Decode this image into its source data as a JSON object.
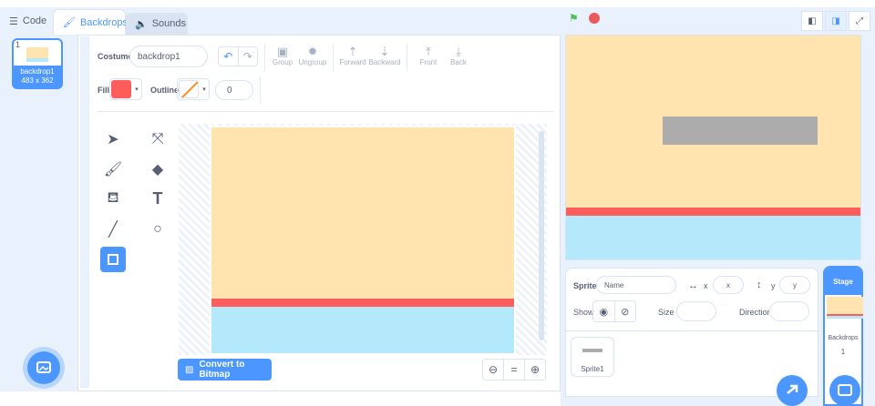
{
  "tabs": {
    "code": "Code",
    "backdrops": "Backdrops",
    "sounds": "Sounds"
  },
  "backdrop_list": {
    "number": "1",
    "name": "backdrop1",
    "size": "483 x 362"
  },
  "costume": {
    "label": "Costume",
    "value": "backdrop1"
  },
  "toolbar": {
    "group": "Group",
    "ungroup": "Ungroup",
    "forward": "Forward",
    "backward": "Backward",
    "front": "Front",
    "back": "Back"
  },
  "fill": {
    "label": "Fill",
    "color": "#ff5c5c"
  },
  "outline": {
    "label": "Outline",
    "width": "0"
  },
  "convert_button": "Convert to Bitmap",
  "zoom": {
    "out": "⊖",
    "reset": "=",
    "in": "⊕"
  },
  "sprite_info": {
    "sprite_label": "Sprite",
    "name_placeholder": "Name",
    "x_label": "x",
    "x_placeholder": "x",
    "y_label": "y",
    "y_placeholder": "y",
    "show_label": "Show",
    "size_label": "Size",
    "direction_label": "Direction"
  },
  "sprites": [
    {
      "name": "Sprite1"
    }
  ],
  "stage_panel": {
    "title": "Stage",
    "backdrops_label": "Backdrops",
    "backdrops_count": "1"
  },
  "colors": {
    "accent": "#4c97ff",
    "sand": "#ffe4b0",
    "red": "#ff5c5c",
    "sky": "#b3e9fb",
    "gray": "#acacac"
  }
}
